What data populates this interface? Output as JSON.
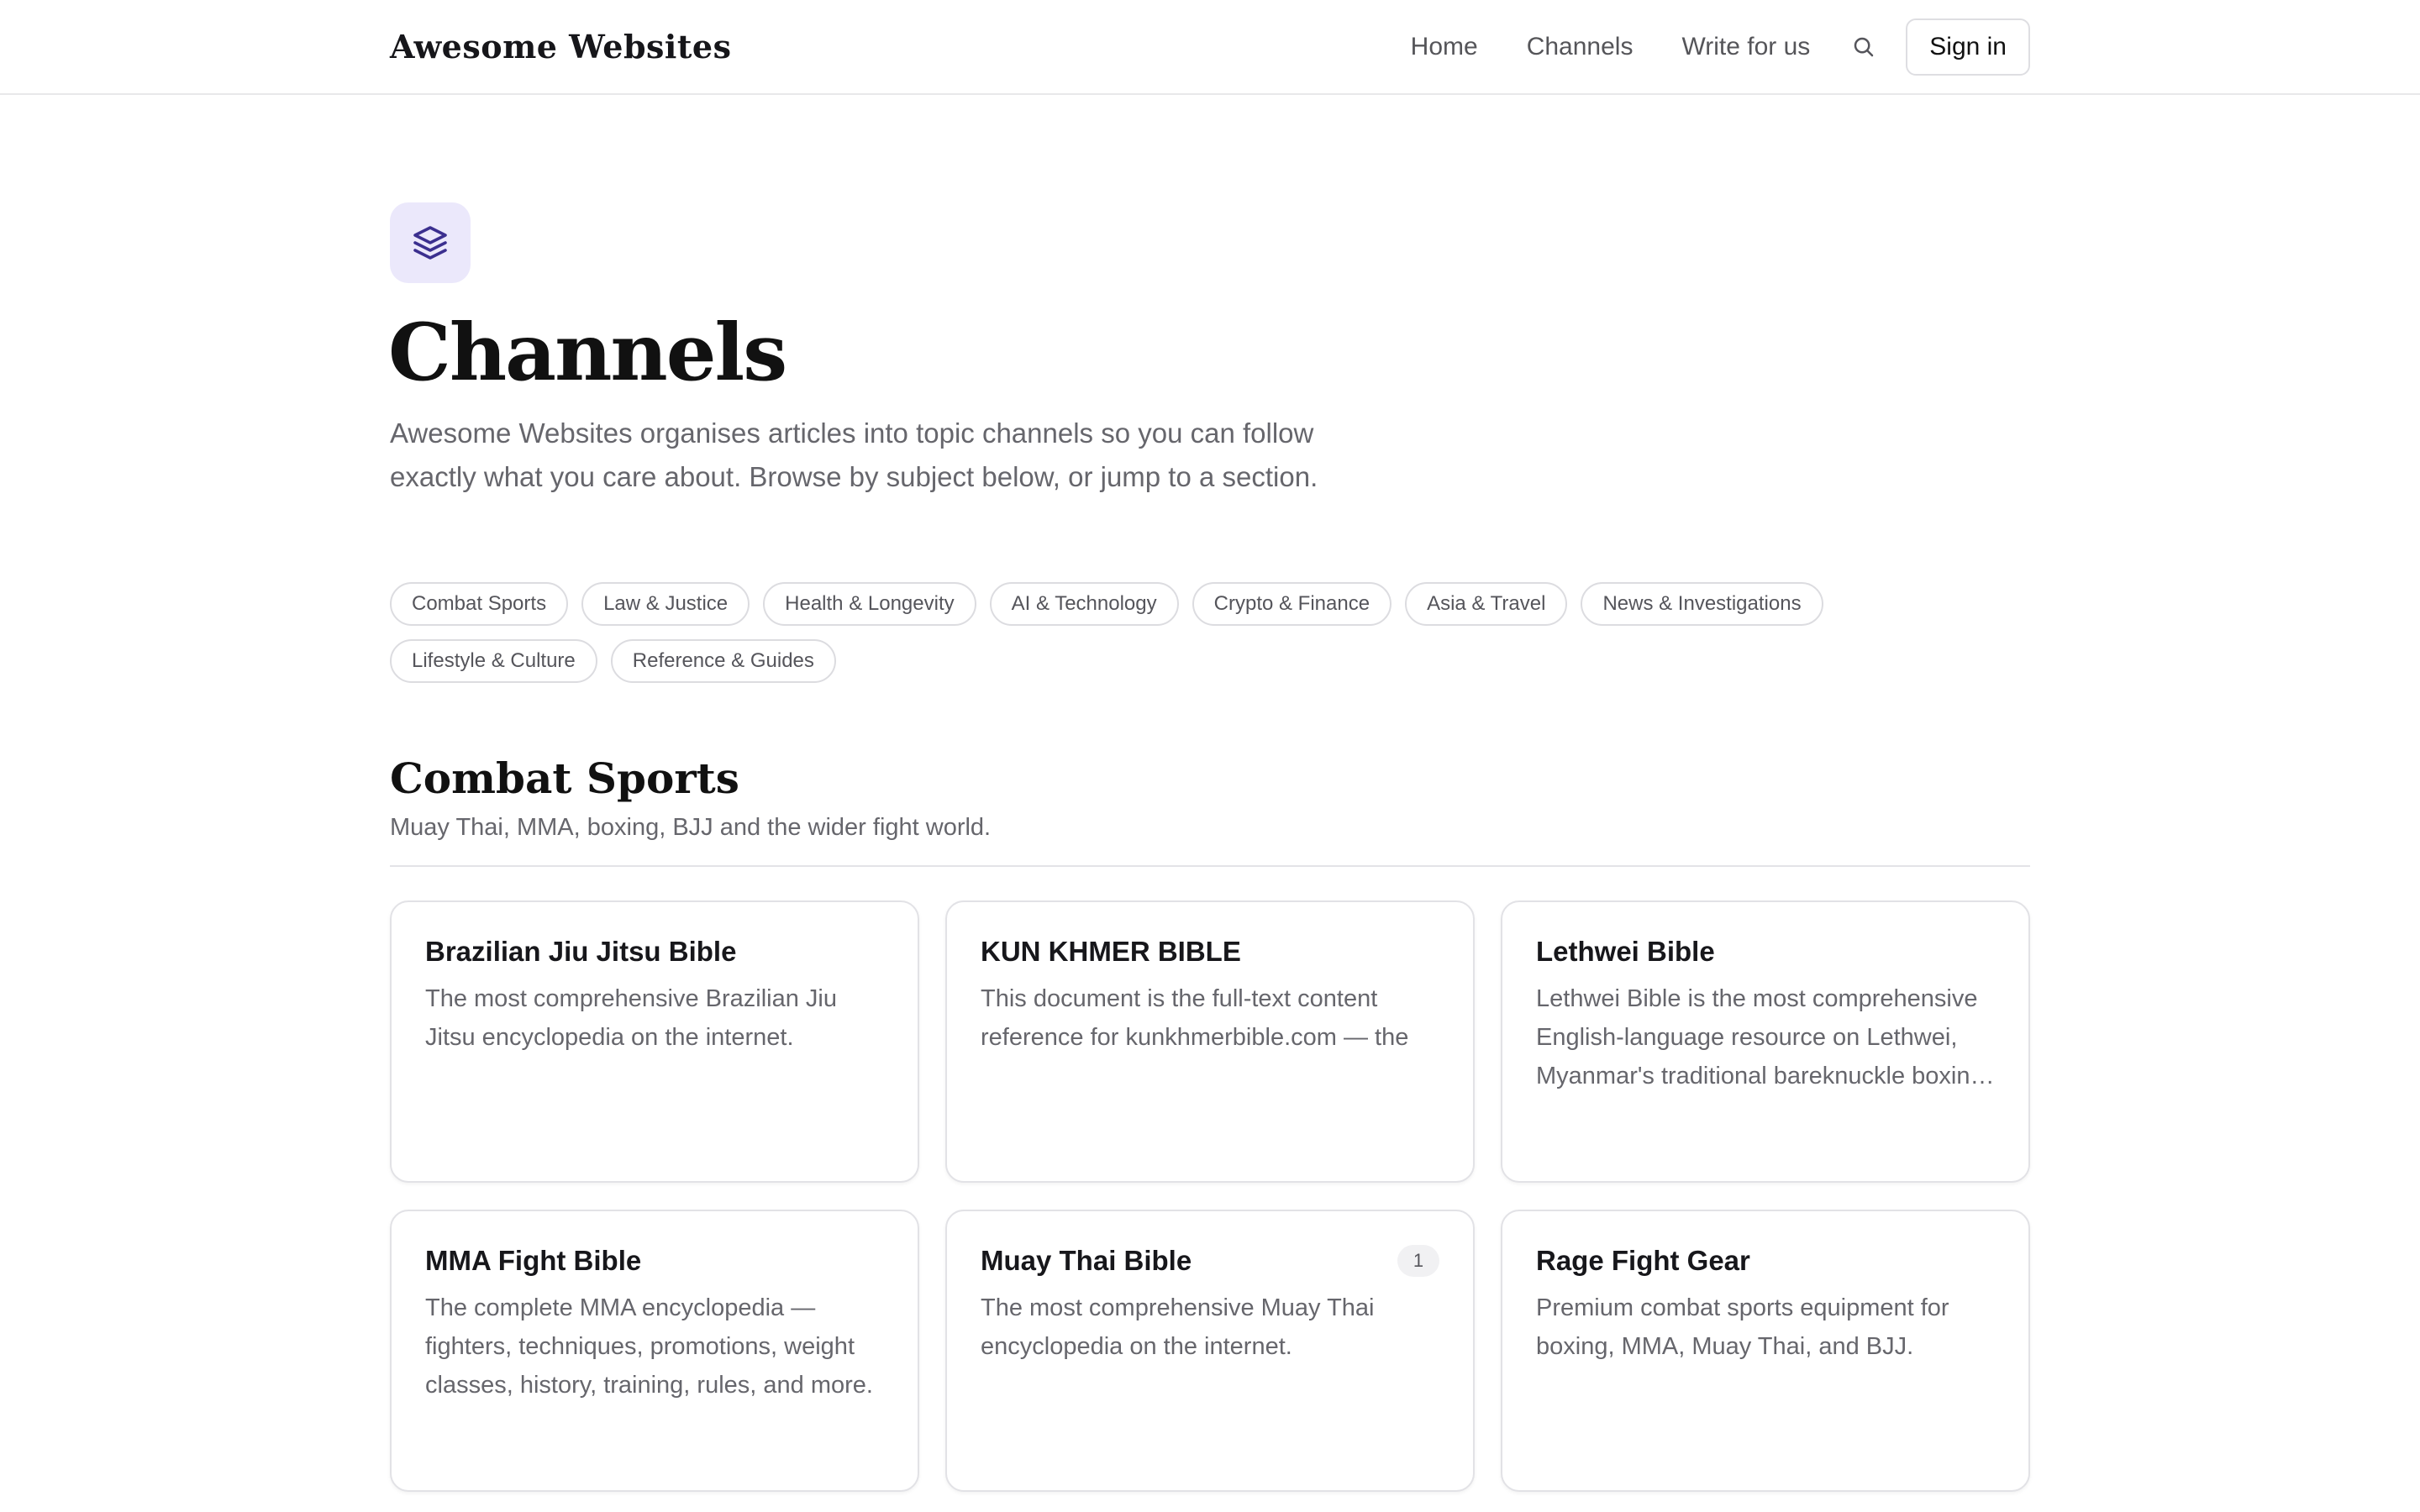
{
  "header": {
    "brand": "Awesome Websites",
    "nav": [
      "Home",
      "Channels",
      "Write for us"
    ],
    "search_icon": "search-icon",
    "signin_label": "Sign in"
  },
  "hero": {
    "icon": "layers-icon",
    "title": "Channels",
    "intro": "Awesome Websites organises articles into topic channels so you can follow exactly what you care about. Browse by subject below, or jump to a section.",
    "chips": [
      "Combat Sports",
      "Law & Justice",
      "Health & Longevity",
      "AI & Technology",
      "Crypto & Finance",
      "Asia & Travel",
      "News & Investigations",
      "Lifestyle & Culture",
      "Reference & Guides"
    ]
  },
  "section": {
    "title": "Combat Sports",
    "subtitle": "Muay Thai, MMA, boxing, BJJ and the wider fight world.",
    "cards": [
      {
        "title": "Brazilian Jiu Jitsu Bible",
        "desc": "The most comprehensive Brazilian Jiu Jitsu encyclopedia on the internet.",
        "count": ""
      },
      {
        "title": "KUN KHMER BIBLE",
        "desc": "This document is the full-text content reference for kunkhmerbible.com — the",
        "count": ""
      },
      {
        "title": "Lethwei Bible",
        "desc": "Lethwei Bible is the most comprehensive English-language resource on Lethwei, Myanmar's traditional bareknuckle boxing art.",
        "count": ""
      },
      {
        "title": "MMA Fight Bible",
        "desc": "The complete MMA encyclopedia — fighters, techniques, promotions, weight classes, history, training, rules, and more.",
        "count": ""
      },
      {
        "title": "Muay Thai Bible",
        "desc": "The most comprehensive Muay Thai encyclopedia on the internet.",
        "count": "1"
      },
      {
        "title": "Rage Fight Gear",
        "desc": "Premium combat sports equipment for boxing, MMA, Muay Thai, and BJJ.",
        "count": ""
      }
    ]
  },
  "colors": {
    "icon_bg": "#ebe8fb",
    "icon_stroke": "#3b2f8f",
    "text_muted": "#66666c",
    "border": "#e2e2e6"
  }
}
